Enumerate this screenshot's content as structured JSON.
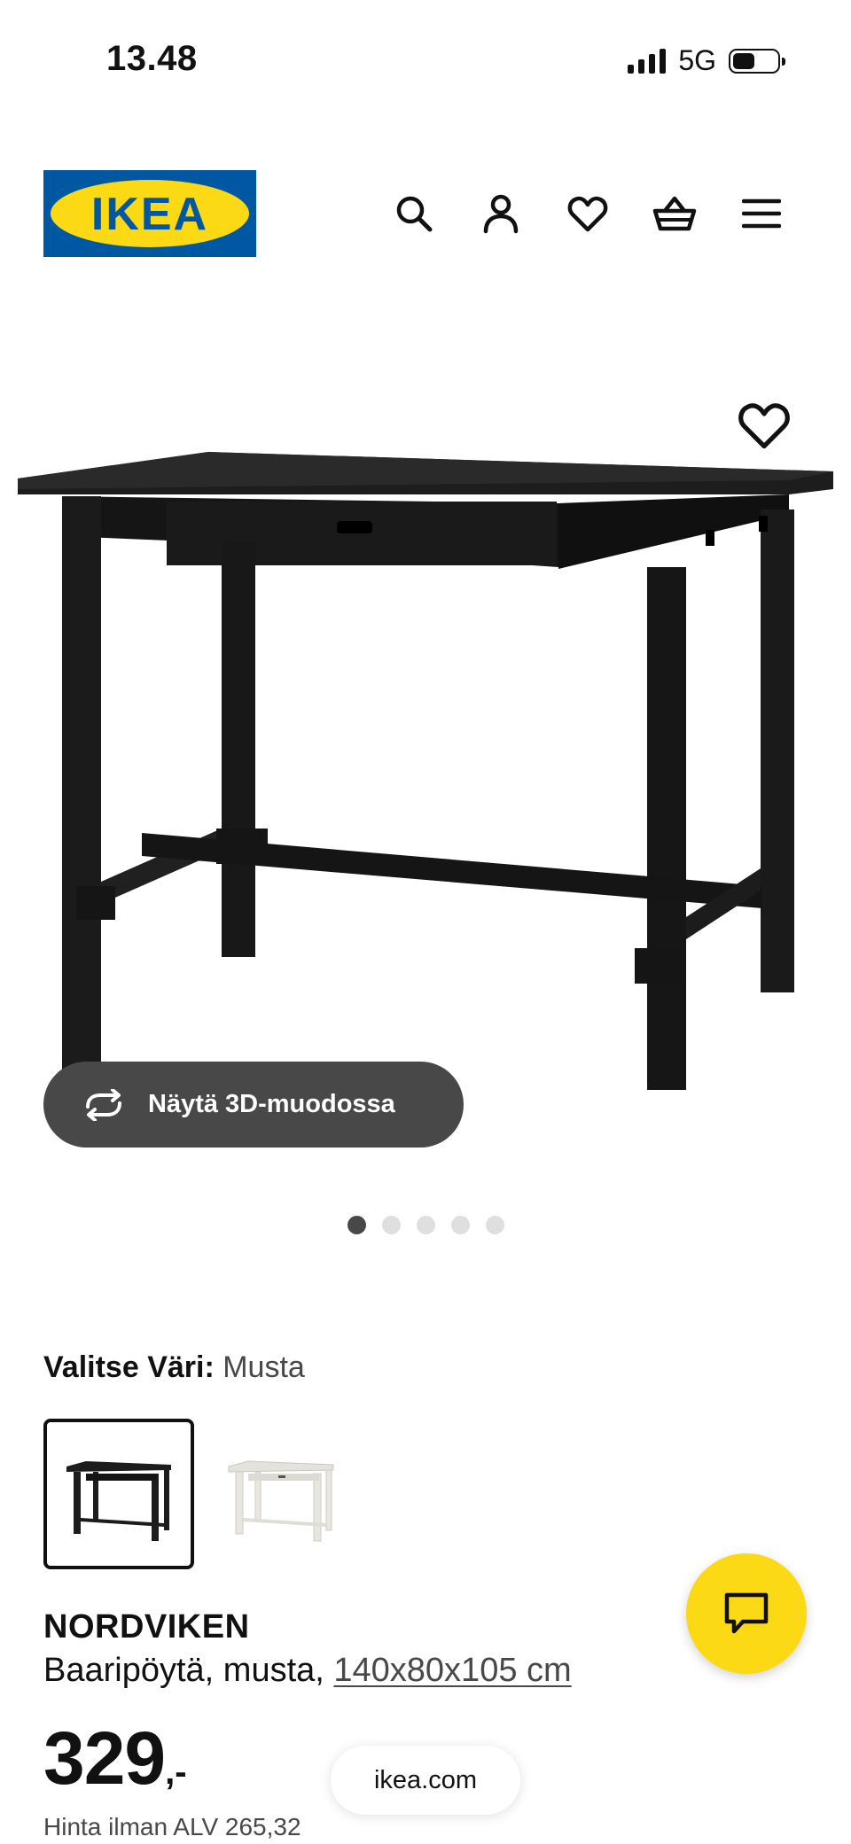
{
  "status_bar": {
    "time": "13.48",
    "network": "5G",
    "battery_level": 0.5
  },
  "header": {
    "logo_text": "IKEA",
    "brand_colors": {
      "blue": "#0058a3",
      "yellow": "#fbd914"
    },
    "icons": [
      "search-icon",
      "user-icon",
      "heart-icon",
      "basket-icon",
      "menu-icon"
    ]
  },
  "gallery": {
    "view_3d_label": "Näytä 3D-muodossa",
    "slide_count": 5,
    "active_slide": 1
  },
  "color_select": {
    "label": "Valitse Väri:",
    "value": "Musta",
    "options": [
      "black",
      "white"
    ]
  },
  "product": {
    "name": "NORDVIKEN",
    "description": "Baaripöytä, musta,",
    "dimensions": "140x80x105 cm",
    "price_int": "329",
    "price_suffix": ",-",
    "vat_text": "Hinta ilman ALV 265,32"
  },
  "browser": {
    "url": "ikea.com"
  }
}
